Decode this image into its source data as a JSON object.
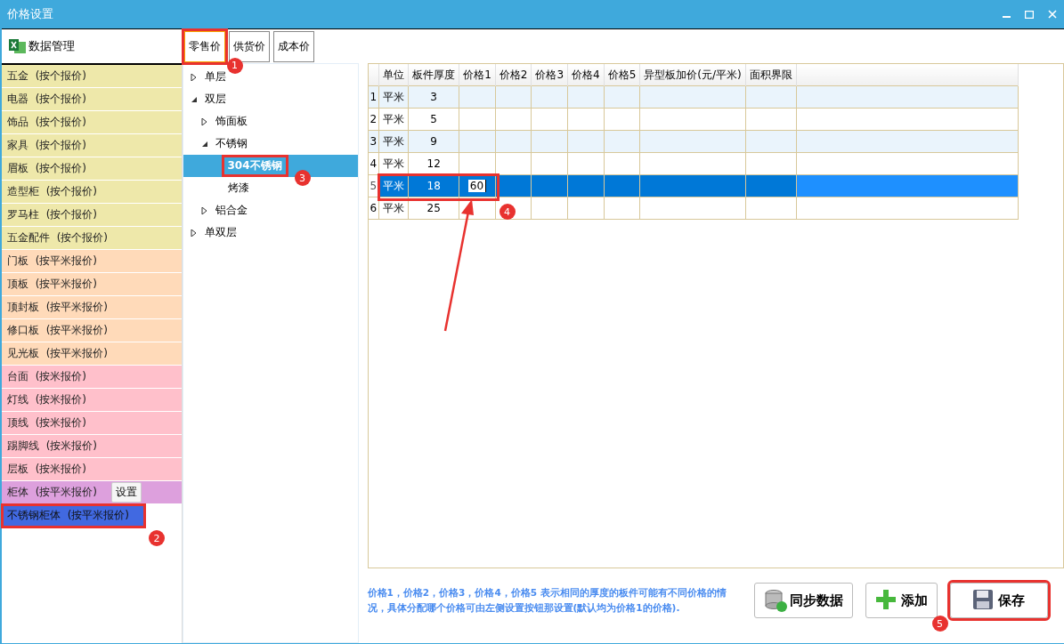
{
  "window": {
    "title": "价格设置"
  },
  "sidebar": {
    "header": "数据管理",
    "items": [
      {
        "name": "五金",
        "mode": "(按个报价)",
        "color": "#eee8aa",
        "selected": false
      },
      {
        "name": "电器",
        "mode": "(按个报价)",
        "color": "#eee8aa",
        "selected": false
      },
      {
        "name": "饰品",
        "mode": "(按个报价)",
        "color": "#eee8aa",
        "selected": false
      },
      {
        "name": "家具",
        "mode": "(按个报价)",
        "color": "#eee8aa",
        "selected": false
      },
      {
        "name": "眉板",
        "mode": "(按个报价)",
        "color": "#eee8aa",
        "selected": false
      },
      {
        "name": "造型柜",
        "mode": "(按个报价)",
        "color": "#eee8aa",
        "selected": false
      },
      {
        "name": "罗马柱",
        "mode": "(按个报价)",
        "color": "#eee8aa",
        "selected": false
      },
      {
        "name": "五金配件",
        "mode": "(按个报价)",
        "color": "#eee8aa",
        "selected": false
      },
      {
        "name": "门板",
        "mode": "(按平米报价)",
        "color": "#ffdab9",
        "selected": false
      },
      {
        "name": "顶板",
        "mode": "(按平米报价)",
        "color": "#ffdab9",
        "selected": false
      },
      {
        "name": "顶封板",
        "mode": "(按平米报价)",
        "color": "#ffdab9",
        "selected": false
      },
      {
        "name": "修口板",
        "mode": "(按平米报价)",
        "color": "#ffdab9",
        "selected": false
      },
      {
        "name": "见光板",
        "mode": "(按平米报价)",
        "color": "#ffdab9",
        "selected": false
      },
      {
        "name": "台面",
        "mode": "(按米报价)",
        "color": "#ffc0cb",
        "selected": false
      },
      {
        "name": "灯线",
        "mode": "(按米报价)",
        "color": "#ffc0cb",
        "selected": false
      },
      {
        "name": "顶线",
        "mode": "(按米报价)",
        "color": "#ffc0cb",
        "selected": false
      },
      {
        "name": "踢脚线",
        "mode": "(按米报价)",
        "color": "#ffc0cb",
        "selected": false
      },
      {
        "name": "层板",
        "mode": "(按米报价)",
        "color": "#ffc0cb",
        "selected": false
      },
      {
        "name": "柜体",
        "mode": "(按平米报价)",
        "color": "#dda0dd",
        "selected": false,
        "button": "设置"
      },
      {
        "name": "不锈钢柜体",
        "mode": "(按平米报价)",
        "color": "#4169e1",
        "selected": true,
        "marker": "2"
      }
    ]
  },
  "tabs": [
    {
      "label": "零售价",
      "selected": true,
      "marker": "1"
    },
    {
      "label": "供货价",
      "selected": false
    },
    {
      "label": "成本价",
      "selected": false
    }
  ],
  "tree": [
    {
      "label": "单层",
      "expanded": false,
      "selected": false
    },
    {
      "label": "双层",
      "expanded": true,
      "selected": false,
      "children": [
        {
          "label": "饰面板",
          "expanded": false,
          "selected": false
        },
        {
          "label": "不锈钢",
          "expanded": true,
          "selected": false,
          "children": [
            {
              "label": "304不锈钢",
              "selected": true,
              "marker": "3"
            },
            {
              "label": "烤漆",
              "selected": false
            }
          ]
        },
        {
          "label": "铝合金",
          "expanded": false,
          "selected": false
        }
      ]
    },
    {
      "label": "单双层",
      "expanded": false,
      "selected": false
    }
  ],
  "table": {
    "columns": [
      "单位",
      "板件厚度",
      "价格1",
      "价格2",
      "价格3",
      "价格4",
      "价格5",
      "异型板加价(元/平米)",
      "面积界限"
    ],
    "rows": [
      {
        "number": "1",
        "cells": [
          "平米",
          "3",
          "",
          "",
          "",
          "",
          "",
          "",
          ""
        ],
        "selected": false
      },
      {
        "number": "2",
        "cells": [
          "平米",
          "5",
          "",
          "",
          "",
          "",
          "",
          "",
          ""
        ],
        "selected": false
      },
      {
        "number": "3",
        "cells": [
          "平米",
          "9",
          "",
          "",
          "",
          "",
          "",
          "",
          ""
        ],
        "selected": false
      },
      {
        "number": "4",
        "cells": [
          "平米",
          "12",
          "",
          "",
          "",
          "",
          "",
          "",
          ""
        ],
        "selected": false
      },
      {
        "number": "5",
        "cells": [
          "平米",
          "18",
          {
            "value": "60",
            "editing": true
          },
          "",
          "",
          "",
          "",
          "",
          ""
        ],
        "selected": true,
        "marker": "4"
      },
      {
        "number": "6",
        "cells": [
          "平米",
          "25",
          "",
          "",
          "",
          "",
          "",
          "",
          ""
        ],
        "selected": false
      }
    ]
  },
  "help_text": "价格1，价格2，价格3，价格4，价格5 表示相同的厚度的板件可能有不同价格的情况，具体分配哪个价格可由左侧设置按钮那设置(默认均为价格1的价格).",
  "buttons": [
    {
      "kind": "sync",
      "label": "同步数据"
    },
    {
      "kind": "add",
      "label": "添加"
    },
    {
      "kind": "save",
      "label": "保存",
      "marker": "5"
    }
  ]
}
